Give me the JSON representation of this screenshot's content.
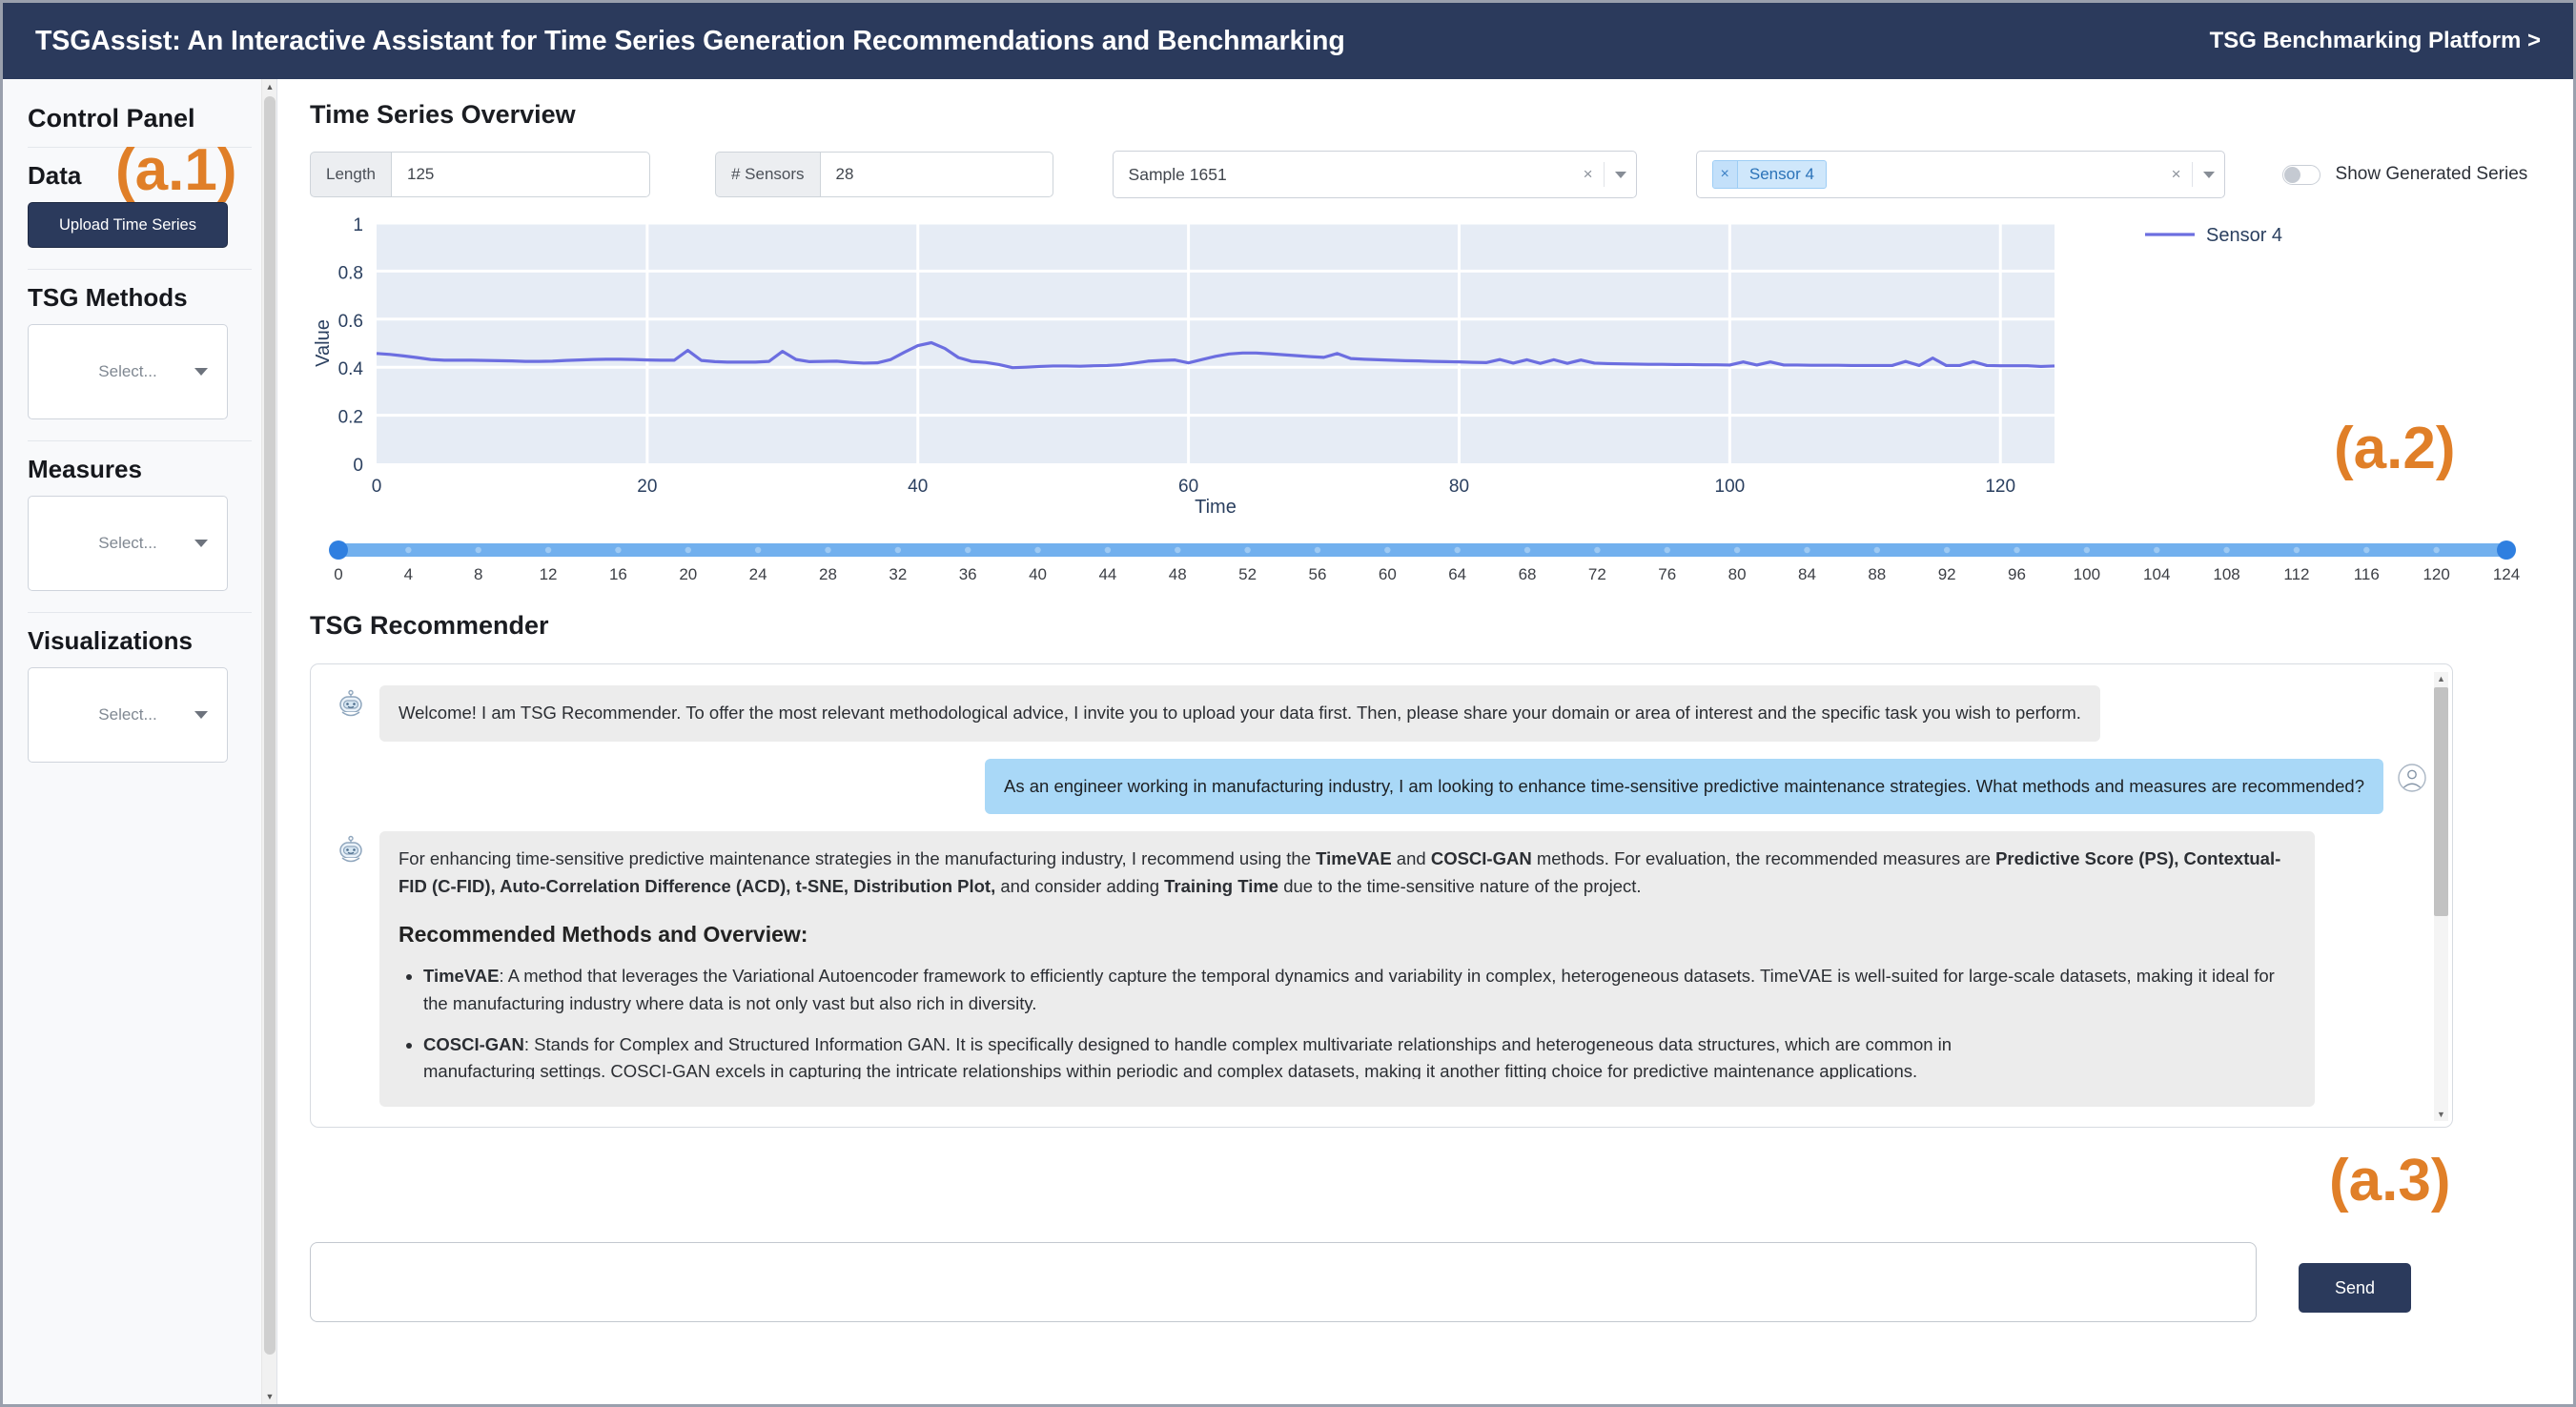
{
  "header": {
    "title": "TSGAssist: An Interactive Assistant for Time Series Generation Recommendations and Benchmarking",
    "link": "TSG Benchmarking Platform >"
  },
  "sidebar": {
    "panel_title": "Control Panel",
    "sections": [
      {
        "heading": "Data",
        "control": "button",
        "label": "Upload Time Series"
      },
      {
        "heading": "TSG Methods",
        "control": "select",
        "placeholder": "Select..."
      },
      {
        "heading": "Measures",
        "control": "select",
        "placeholder": "Select..."
      },
      {
        "heading": "Visualizations",
        "control": "select",
        "placeholder": "Select..."
      }
    ]
  },
  "overview": {
    "title": "Time Series Overview",
    "length_label": "Length",
    "length_value": "125",
    "sensors_label": "# Sensors",
    "sensors_value": "28",
    "sample_value": "Sample 1651",
    "sensor_chip": "Sensor 4",
    "toggle_label": "Show Generated Series",
    "toggle_on": false
  },
  "slider": {
    "min": 0,
    "max": 124,
    "ticks": [
      0,
      4,
      8,
      12,
      16,
      20,
      24,
      28,
      32,
      36,
      40,
      44,
      48,
      52,
      56,
      60,
      64,
      68,
      72,
      76,
      80,
      84,
      88,
      92,
      96,
      100,
      104,
      108,
      112,
      116,
      120,
      124
    ]
  },
  "chat": {
    "title": "TSG Recommender",
    "messages": [
      {
        "role": "assistant",
        "text": "Welcome! I am TSG Recommender. To offer the most relevant methodological advice, I invite you to upload your data first. Then, please share your domain or area of interest and the specific task you wish to perform."
      },
      {
        "role": "user",
        "text": "As an engineer working in manufacturing industry, I am looking to enhance time-sensitive predictive maintenance strategies. What methods and measures are recommended?"
      }
    ],
    "answer": {
      "p1_a": "For enhancing time-sensitive predictive maintenance strategies in the manufacturing industry, I recommend using the ",
      "p1_b1": "TimeVAE",
      "p1_c": " and ",
      "p1_b2": "COSCI-GAN",
      "p1_d": " methods. For evaluation, the recommended measures are ",
      "p1_b3": "Predictive Score (PS), Contextual-FID (C-FID), Auto-Correlation Difference (ACD), t-SNE, Distribution Plot,",
      "p1_e": " and consider adding ",
      "p1_b4": "Training Time",
      "p1_f": " due to the time-sensitive nature of the project.",
      "heading": "Recommended Methods and Overview:",
      "bullets": [
        {
          "name": "TimeVAE",
          "text": ": A method that leverages the Variational Autoencoder framework to efficiently capture the temporal dynamics and variability in complex, heterogeneous datasets. TimeVAE is well-suited for large-scale datasets, making it ideal for the manufacturing industry where data is not only vast but also rich in diversity."
        },
        {
          "name": "COSCI-GAN",
          "text": ": Stands for Complex and Structured Information GAN. It is specifically designed to handle complex multivariate relationships and heterogeneous data structures, which are common in",
          "clipped": "manufacturing settings. COSCI-GAN excels in capturing the intricate relationships within periodic and complex datasets, making it another fitting choice for predictive maintenance applications."
        }
      ]
    },
    "input_value": "",
    "input_placeholder": "",
    "send_label": "Send"
  },
  "annotations": {
    "a1": "(a.1)",
    "a2": "(a.2)",
    "a3": "(a.3)"
  },
  "colors": {
    "navbar": "#2b3a5c",
    "accent_line": "#6c6ee0",
    "annotation": "#e07f28",
    "chip": "#cfe7fb",
    "user_bubble": "#a9d8f7",
    "assistant_bubble": "#ececec",
    "slider": "#72b0ee",
    "plot_bg": "#e6ecf5"
  },
  "chart_data": {
    "type": "line",
    "title": "",
    "xlabel": "Time",
    "ylabel": "Value",
    "xlim": [
      0,
      124
    ],
    "ylim": [
      0,
      1
    ],
    "xticks": [
      0,
      20,
      40,
      60,
      80,
      100,
      120
    ],
    "yticks": [
      0,
      0.2,
      0.4,
      0.6,
      0.8,
      1
    ],
    "grid": true,
    "legend_position": "right",
    "series": [
      {
        "name": "Sensor 4",
        "color": "#6c6ee0",
        "x": [
          0,
          1,
          2,
          3,
          4,
          5,
          6,
          7,
          8,
          9,
          10,
          11,
          12,
          13,
          14,
          15,
          16,
          17,
          18,
          19,
          20,
          21,
          22,
          23,
          24,
          25,
          26,
          27,
          28,
          29,
          30,
          31,
          32,
          33,
          34,
          35,
          36,
          37,
          38,
          39,
          40,
          41,
          42,
          43,
          44,
          45,
          46,
          47,
          48,
          49,
          50,
          51,
          52,
          53,
          54,
          55,
          56,
          57,
          58,
          59,
          60,
          61,
          62,
          63,
          64,
          65,
          66,
          67,
          68,
          69,
          70,
          71,
          72,
          73,
          74,
          75,
          76,
          77,
          78,
          79,
          80,
          81,
          82,
          83,
          84,
          85,
          86,
          87,
          88,
          89,
          90,
          91,
          92,
          93,
          94,
          95,
          96,
          97,
          98,
          99,
          100,
          101,
          102,
          103,
          104,
          105,
          106,
          107,
          108,
          109,
          110,
          111,
          112,
          113,
          114,
          115,
          116,
          117,
          118,
          119,
          120,
          121,
          122,
          123,
          124
        ],
        "y": [
          0.457,
          0.453,
          0.447,
          0.44,
          0.432,
          0.429,
          0.429,
          0.429,
          0.428,
          0.427,
          0.426,
          0.424,
          0.424,
          0.425,
          0.428,
          0.43,
          0.432,
          0.433,
          0.433,
          0.432,
          0.43,
          0.429,
          0.429,
          0.47,
          0.428,
          0.423,
          0.421,
          0.421,
          0.421,
          0.424,
          0.466,
          0.432,
          0.423,
          0.424,
          0.425,
          0.42,
          0.417,
          0.418,
          0.432,
          0.462,
          0.49,
          0.502,
          0.478,
          0.44,
          0.424,
          0.42,
          0.411,
          0.398,
          0.4,
          0.403,
          0.405,
          0.405,
          0.404,
          0.406,
          0.407,
          0.41,
          0.417,
          0.425,
          0.428,
          0.43,
          0.418,
          0.432,
          0.445,
          0.455,
          0.459,
          0.459,
          0.456,
          0.452,
          0.448,
          0.444,
          0.441,
          0.457,
          0.436,
          0.433,
          0.431,
          0.429,
          0.427,
          0.426,
          0.424,
          0.423,
          0.422,
          0.42,
          0.419,
          0.432,
          0.417,
          0.431,
          0.416,
          0.431,
          0.416,
          0.43,
          0.417,
          0.415,
          0.414,
          0.413,
          0.412,
          0.412,
          0.411,
          0.411,
          0.41,
          0.41,
          0.409,
          0.422,
          0.409,
          0.422,
          0.409,
          0.409,
          0.408,
          0.408,
          0.408,
          0.407,
          0.407,
          0.407,
          0.407,
          0.424,
          0.407,
          0.438,
          0.407,
          0.407,
          0.423,
          0.407,
          0.406,
          0.406,
          0.406,
          0.403,
          0.405
        ],
        "y_continued": [
          0.404,
          0.403,
          0.403
        ]
      }
    ]
  }
}
